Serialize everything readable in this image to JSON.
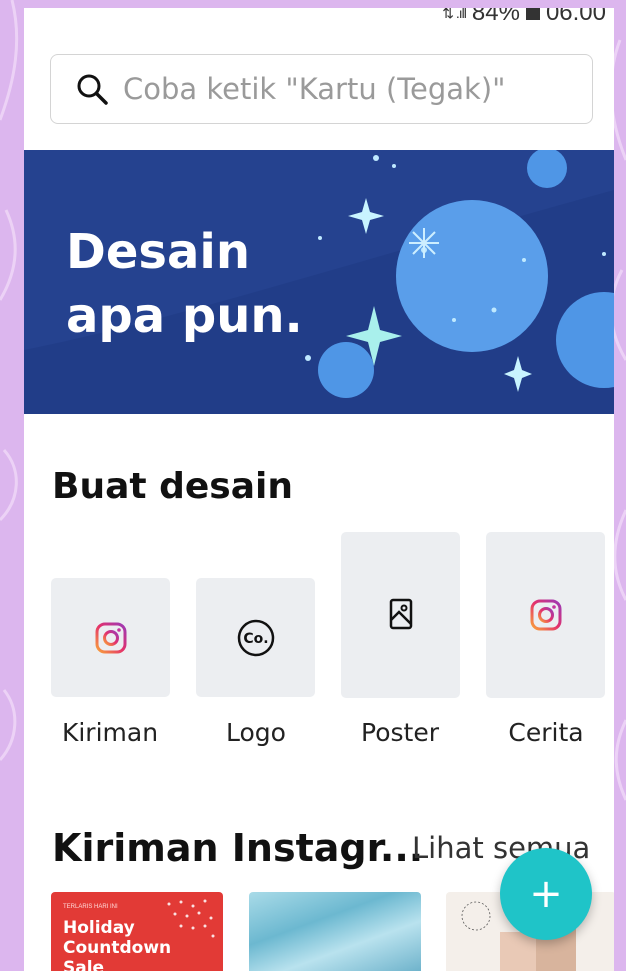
{
  "status_bar": {
    "battery": "84%",
    "time": "06.00"
  },
  "search": {
    "placeholder": "Coba ketik \"Kartu (Tegak)\""
  },
  "banner": {
    "line1": "Desain",
    "line2": "apa pun."
  },
  "create": {
    "title": "Buat desain",
    "items": [
      {
        "label": "Kiriman Instagram",
        "icon": "instagram-icon"
      },
      {
        "label": "Logo",
        "icon": "logo-co-icon"
      },
      {
        "label": "Poster",
        "icon": "image-icon"
      },
      {
        "label": "Cerita Instagram",
        "icon": "instagram-icon"
      }
    ]
  },
  "instagram_posts": {
    "title": "Kiriman Instagr...",
    "see_all": "Lihat semua",
    "thumbs": [
      {
        "small": "TERLARIS HARI INI",
        "text": "Holiday Countdown Sale"
      },
      {
        "text": ""
      },
      {
        "text": ""
      }
    ]
  },
  "fab": {
    "label": "+"
  },
  "colors": {
    "brand_teal": "#1fc4c8",
    "banner_blue": "#25428f",
    "accent_red": "#e23a36"
  }
}
